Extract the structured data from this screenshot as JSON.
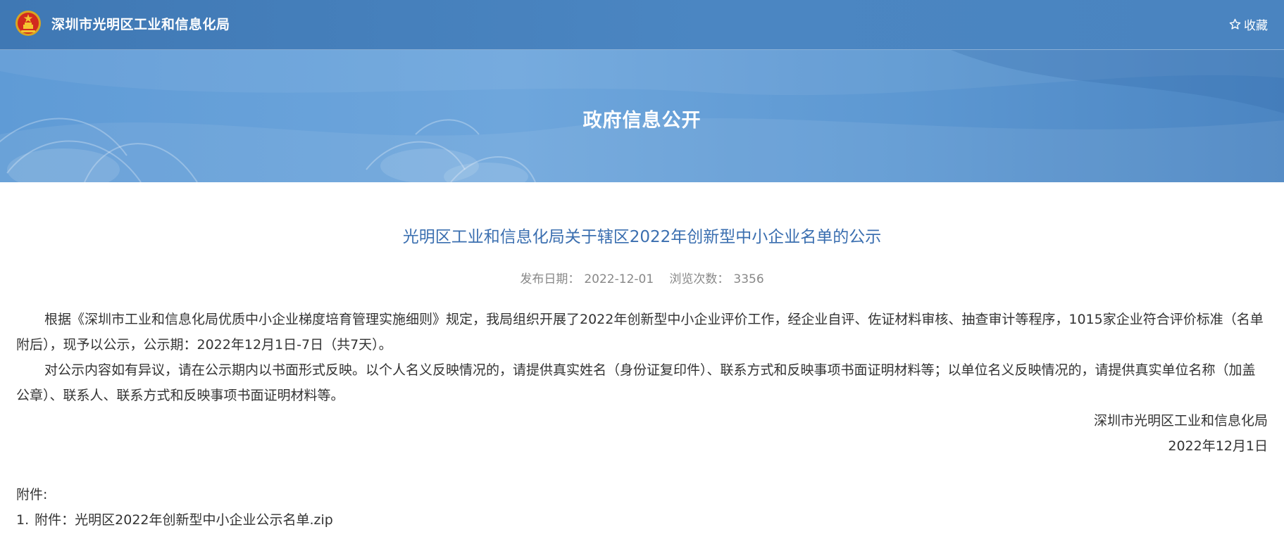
{
  "header": {
    "site_title": "深圳市光明区工业和信息化局",
    "favorite_label": "收藏"
  },
  "banner": {
    "title": "政府信息公开"
  },
  "article": {
    "title": "光明区工业和信息化局关于辖区2022年创新型中小企业名单的公示",
    "publish_date_label": "发布日期：",
    "publish_date": "2022-12-01",
    "views_label": "浏览次数：",
    "views": "3356",
    "paragraphs": [
      "根据《深圳市工业和信息化局优质中小企业梯度培育管理实施细则》规定，我局组织开展了2022年创新型中小企业评价工作，经企业自评、佐证材料审核、抽查审计等程序，1015家企业符合评价标准（名单附后），现予以公示，公示期：2022年12月1日-7日（共7天）。",
      "对公示内容如有异议，请在公示期内以书面形式反映。以个人名义反映情况的，请提供真实姓名（身份证复印件）、联系方式和反映事项书面证明材料等；以单位名义反映情况的，请提供真实单位名称（加盖公章）、联系人、联系方式和反映事项书面证明材料等。"
    ],
    "signature_org": "深圳市光明区工业和信息化局",
    "signature_date": "2022年12月1日",
    "attachments_label": "附件:",
    "attachments": [
      {
        "num": "1.",
        "prefix": "附件：",
        "name": "光明区2022年创新型中小企业公示名单.zip"
      }
    ]
  },
  "colors": {
    "header_bg": "#4580bd",
    "banner_bg": "#6aa3da",
    "title_blue": "#3b6fb0",
    "meta_gray": "#888888"
  },
  "icons": {
    "emblem": "national-emblem-icon",
    "favorite": "star-icon"
  }
}
